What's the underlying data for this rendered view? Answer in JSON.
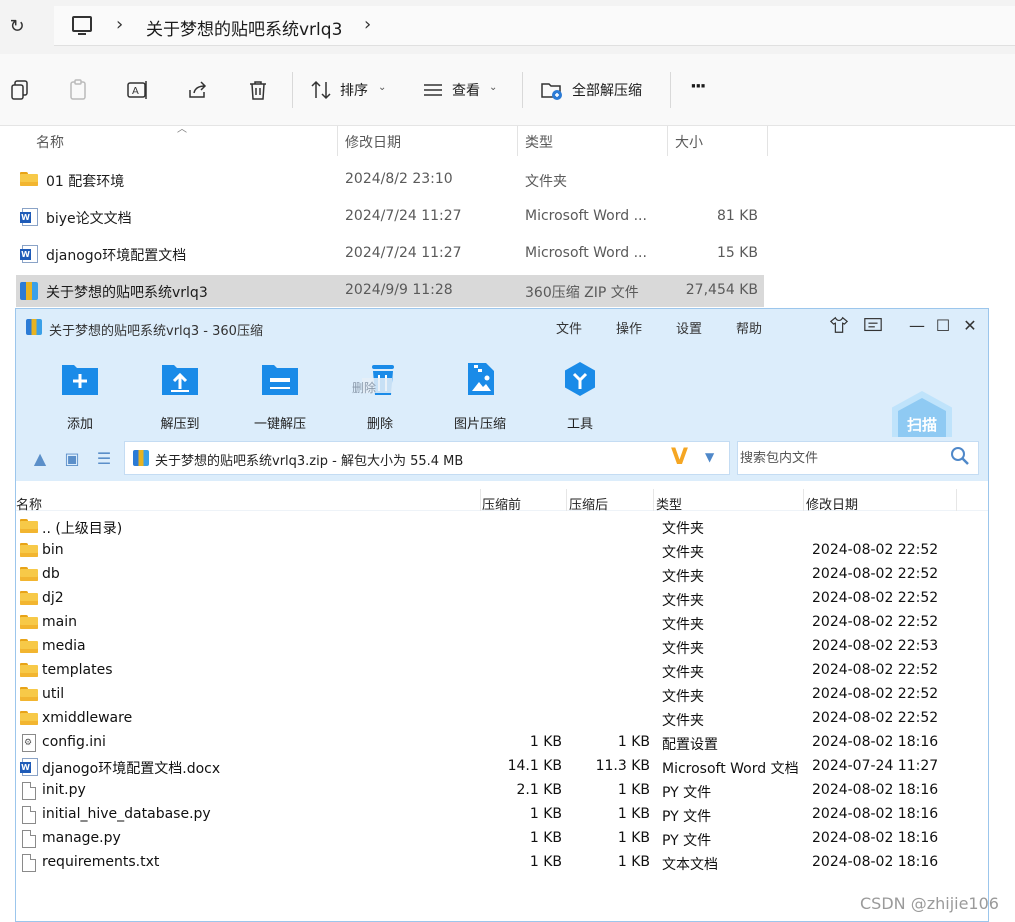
{
  "explorer": {
    "breadcrumb": "关于梦想的贴吧系统vrlq3",
    "toolbar": {
      "sort_label": "排序",
      "view_label": "查看",
      "extract_all_label": "全部解压缩",
      "more_label": "···"
    },
    "columns": {
      "name": "名称",
      "date": "修改日期",
      "type": "类型",
      "size": "大小"
    },
    "files": [
      {
        "icon": "folder-icon",
        "name": "01 配套环境",
        "date": "2024/8/2 23:10",
        "type": "文件夹",
        "size": ""
      },
      {
        "icon": "word-doc-icon",
        "name": "biye论文文档",
        "date": "2024/7/24 11:27",
        "type": "Microsoft Word ...",
        "size": "81 KB"
      },
      {
        "icon": "word-doc-icon",
        "name": "djanogo环境配置文档",
        "date": "2024/7/24 11:27",
        "type": "Microsoft Word ...",
        "size": "15 KB"
      },
      {
        "icon": "zip-archive-icon",
        "name": "关于梦想的贴吧系统vrlq3",
        "date": "2024/9/9 11:28",
        "type": "360压缩 ZIP 文件",
        "size": "27,454 KB"
      }
    ]
  },
  "zip_window": {
    "title": "关于梦想的贴吧系统vrlq3 - 360压缩",
    "menu": [
      "文件",
      "操作",
      "设置",
      "帮助"
    ],
    "tools": [
      {
        "icon": "add-icon",
        "label": "添加"
      },
      {
        "icon": "extract-to-icon",
        "label": "解压到"
      },
      {
        "icon": "one-click-extract-icon",
        "label": "一键解压"
      },
      {
        "icon": "delete-icon",
        "label": "删除"
      },
      {
        "icon": "image-compress-icon",
        "label": "图片压缩"
      },
      {
        "icon": "tools-icon",
        "label": "工具"
      }
    ],
    "delete_overlay": "删除",
    "scan_label": "扫描",
    "path": "关于梦想的贴吧系统vrlq3.zip - 解包大小为 55.4 MB",
    "search_placeholder": "搜索包内文件",
    "columns": {
      "name": "名称",
      "packed": "压缩前",
      "unpacked": "压缩后",
      "type": "类型",
      "date": "修改日期"
    },
    "entries": [
      {
        "icon": "folder-icon",
        "name": ".. (上级目录)",
        "packed": "",
        "unpacked": "",
        "type": "文件夹",
        "date": ""
      },
      {
        "icon": "folder-icon",
        "name": "bin",
        "packed": "",
        "unpacked": "",
        "type": "文件夹",
        "date": "2024-08-02 22:52"
      },
      {
        "icon": "folder-icon",
        "name": "db",
        "packed": "",
        "unpacked": "",
        "type": "文件夹",
        "date": "2024-08-02 22:52"
      },
      {
        "icon": "folder-icon",
        "name": "dj2",
        "packed": "",
        "unpacked": "",
        "type": "文件夹",
        "date": "2024-08-02 22:52"
      },
      {
        "icon": "folder-icon",
        "name": "main",
        "packed": "",
        "unpacked": "",
        "type": "文件夹",
        "date": "2024-08-02 22:52"
      },
      {
        "icon": "folder-icon",
        "name": "media",
        "packed": "",
        "unpacked": "",
        "type": "文件夹",
        "date": "2024-08-02 22:53"
      },
      {
        "icon": "folder-icon",
        "name": "templates",
        "packed": "",
        "unpacked": "",
        "type": "文件夹",
        "date": "2024-08-02 22:52"
      },
      {
        "icon": "folder-icon",
        "name": "util",
        "packed": "",
        "unpacked": "",
        "type": "文件夹",
        "date": "2024-08-02 22:52"
      },
      {
        "icon": "folder-icon",
        "name": "xmiddleware",
        "packed": "",
        "unpacked": "",
        "type": "文件夹",
        "date": "2024-08-02 22:52"
      },
      {
        "icon": "config-file-icon",
        "name": "config.ini",
        "packed": "1 KB",
        "unpacked": "1 KB",
        "type": "配置设置",
        "date": "2024-08-02 18:16"
      },
      {
        "icon": "word-doc-icon",
        "name": "djanogo环境配置文档.docx",
        "packed": "14.1 KB",
        "unpacked": "11.3 KB",
        "type": "Microsoft Word 文档",
        "date": "2024-07-24 11:27"
      },
      {
        "icon": "file-icon",
        "name": "init.py",
        "packed": "2.1 KB",
        "unpacked": "1 KB",
        "type": "PY 文件",
        "date": "2024-08-02 18:16"
      },
      {
        "icon": "file-icon",
        "name": "initial_hive_database.py",
        "packed": "1 KB",
        "unpacked": "1 KB",
        "type": "PY 文件",
        "date": "2024-08-02 18:16"
      },
      {
        "icon": "file-icon",
        "name": "manage.py",
        "packed": "1 KB",
        "unpacked": "1 KB",
        "type": "PY 文件",
        "date": "2024-08-02 18:16"
      },
      {
        "icon": "file-icon",
        "name": "requirements.txt",
        "packed": "1 KB",
        "unpacked": "1 KB",
        "type": "文本文档",
        "date": "2024-08-02 18:16"
      }
    ]
  },
  "watermark": "CSDN @zhijie106"
}
